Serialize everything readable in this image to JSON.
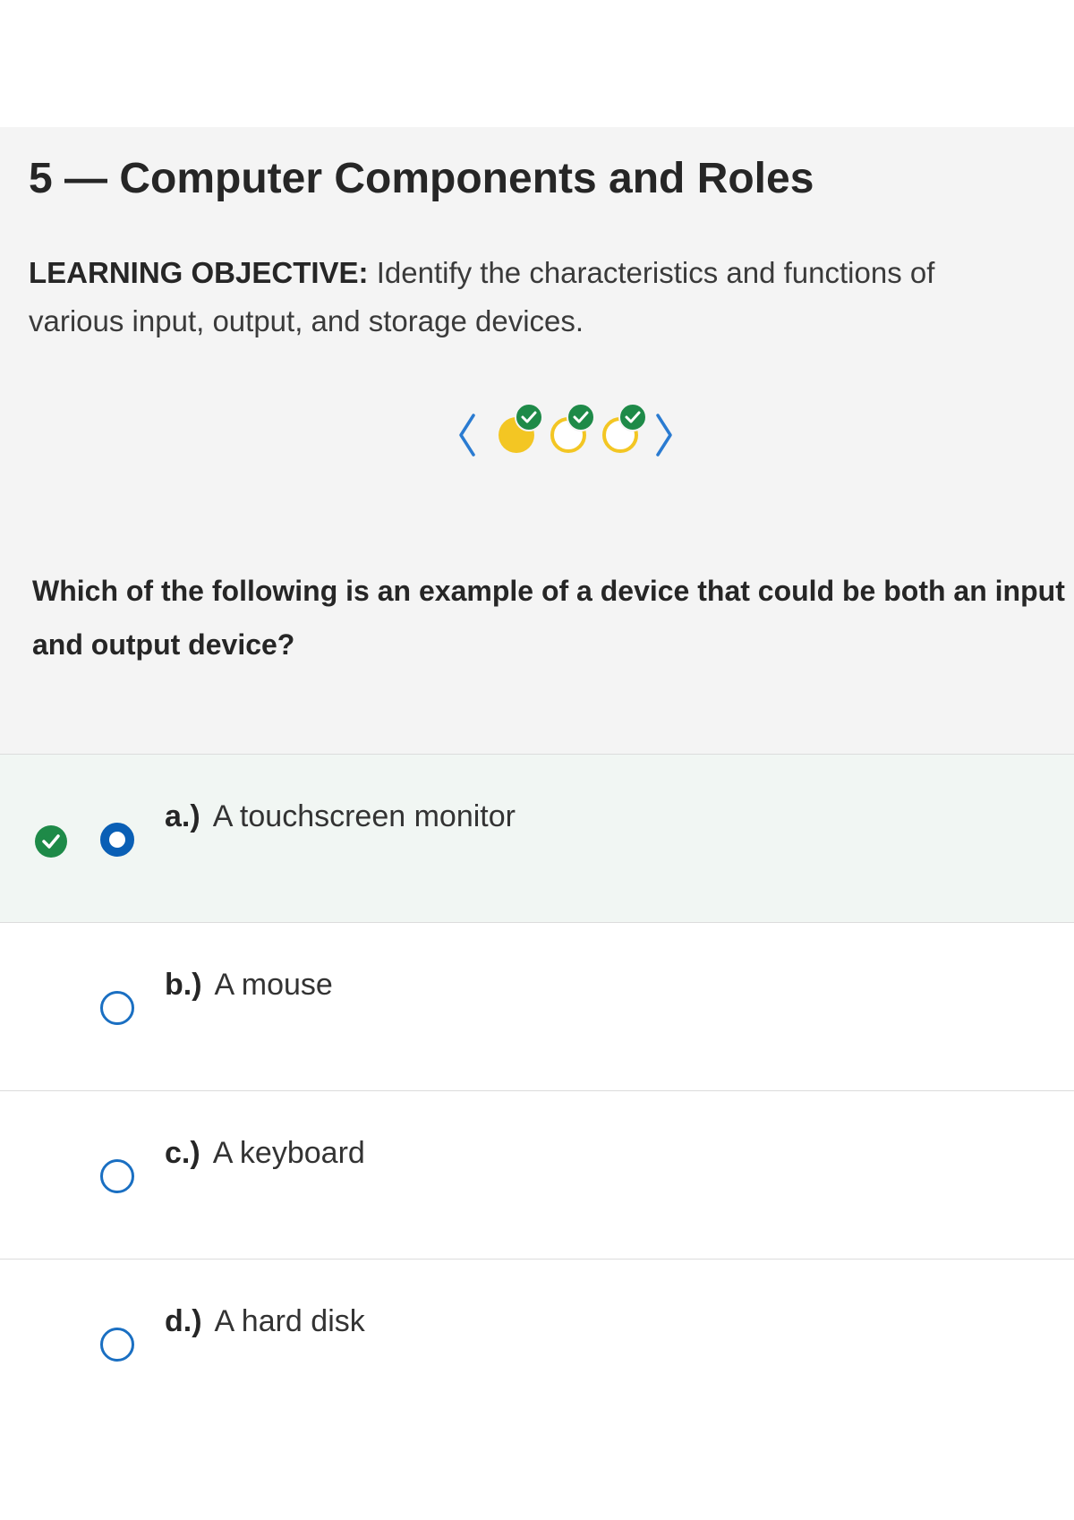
{
  "page": {
    "title": "5 — Computer Components and Roles"
  },
  "objective": {
    "label": "LEARNING OBJECTIVE:",
    "text": "Identify the characteristics and functions of various input, output, and storage devices."
  },
  "progress": {
    "prev_icon": "chevron-left-icon",
    "next_icon": "chevron-right-icon",
    "steps": [
      {
        "state": "current",
        "correct": true
      },
      {
        "state": "pending",
        "correct": true
      },
      {
        "state": "pending",
        "correct": true
      }
    ],
    "colors": {
      "current": "#f3c623",
      "ring": "#f3c623",
      "check": "#1e8a48",
      "arrow": "#2a7bd1"
    }
  },
  "question": {
    "text": "Which of the following is an example of a device that could be both an input and output device?"
  },
  "options": [
    {
      "letter": "a.)",
      "text": "A touchscreen monitor",
      "selected": true,
      "correct": true
    },
    {
      "letter": "b.)",
      "text": "A mouse",
      "selected": false,
      "correct": false
    },
    {
      "letter": "c.)",
      "text": "A keyboard",
      "selected": false,
      "correct": false
    },
    {
      "letter": "d.)",
      "text": "A hard disk",
      "selected": false,
      "correct": false
    }
  ],
  "colors": {
    "selected_bg": "#f1f6f3",
    "radio": "#1a6fc2",
    "correct": "#1e8a48"
  }
}
